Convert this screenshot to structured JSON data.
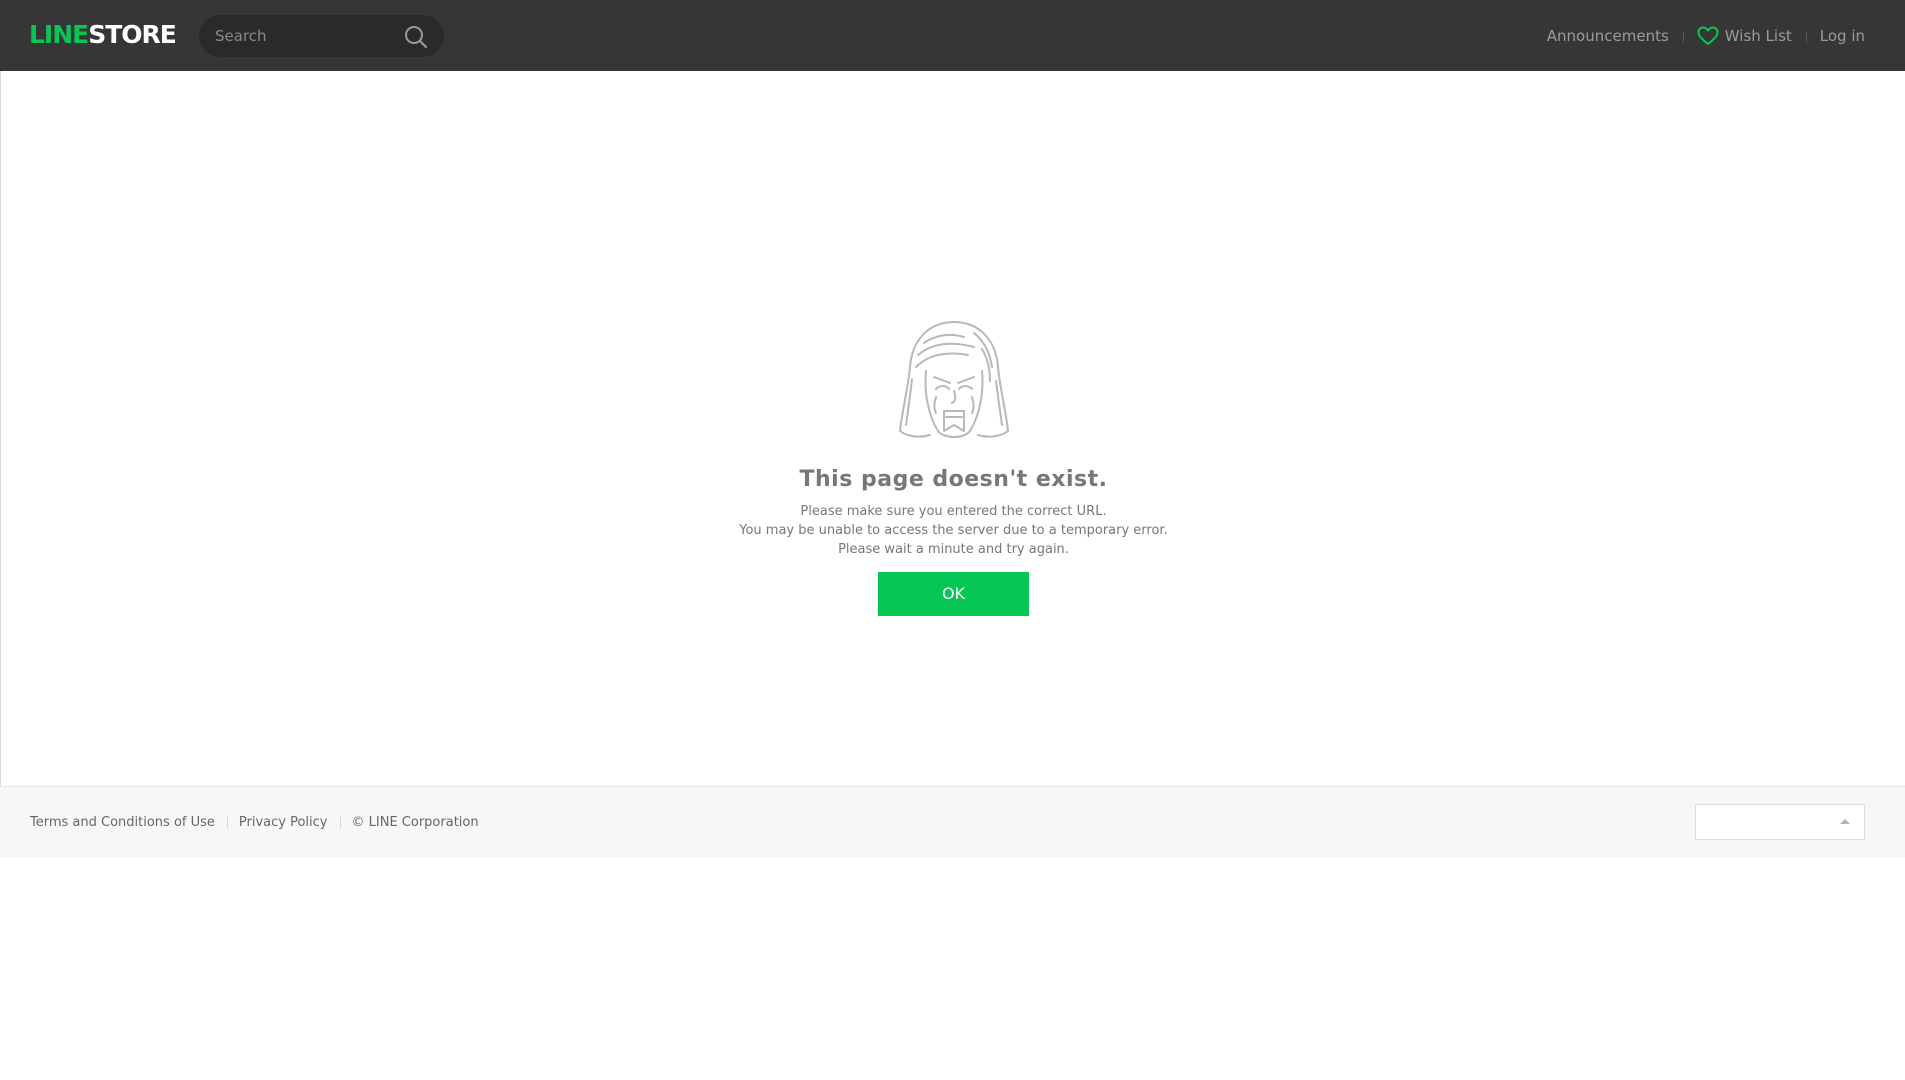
{
  "header": {
    "logo": {
      "line": "LINE",
      "store": "STORE"
    },
    "search": {
      "placeholder": "Search",
      "value": "",
      "icon": "search-icon"
    },
    "nav": {
      "announcements": "Announcements",
      "wishlist": "Wish List",
      "wishlist_icon": "heart-icon",
      "login": "Log in"
    }
  },
  "error": {
    "illustration": "crying-character-icon",
    "title": "This page doesn't exist.",
    "lines": [
      "Please make sure you entered the correct URL.",
      "You may be unable to access the server due to a temporary error.",
      "Please wait a minute and try again."
    ],
    "ok_label": "OK"
  },
  "footer": {
    "terms": "Terms and Conditions of Use",
    "privacy": "Privacy Policy",
    "copyright": "© LINE Corporation",
    "language": {
      "value": "",
      "icon": "caret-up-icon"
    }
  },
  "colors": {
    "brand_green": "#06c755",
    "header_bg": "#363636",
    "footer_bg": "#f7f7f9",
    "text_gray": "#777777"
  }
}
